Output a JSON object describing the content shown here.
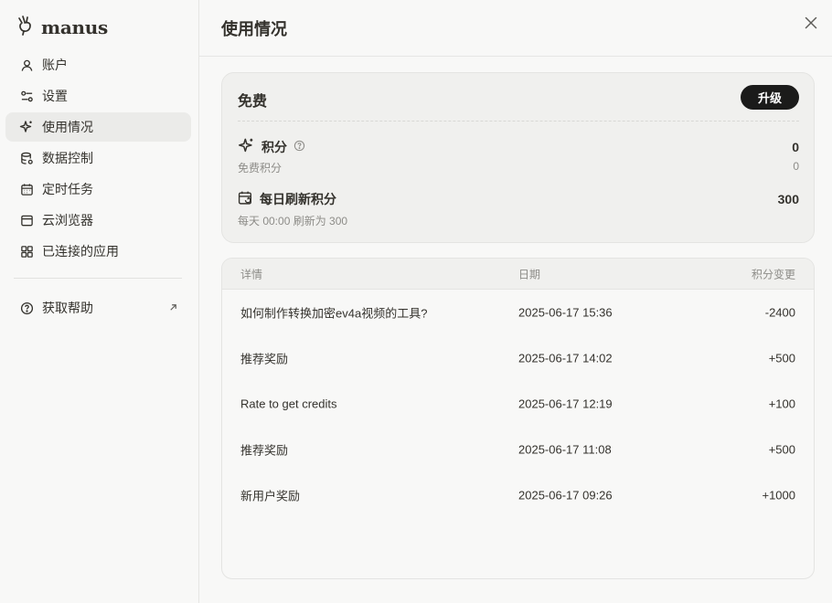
{
  "brand": {
    "name": "manus"
  },
  "sidebar": {
    "items": [
      {
        "label": "账户",
        "icon": "user-icon"
      },
      {
        "label": "设置",
        "icon": "sliders-icon"
      },
      {
        "label": "使用情况",
        "icon": "sparkle-icon",
        "active": true
      },
      {
        "label": "数据控制",
        "icon": "database-icon"
      },
      {
        "label": "定时任务",
        "icon": "calendar-icon"
      },
      {
        "label": "云浏览器",
        "icon": "browser-icon"
      },
      {
        "label": "已连接的应用",
        "icon": "grid-icon"
      }
    ],
    "help": {
      "label": "获取帮助",
      "icon": "help-circle-icon",
      "ext_icon": "external-arrow-icon"
    }
  },
  "header": {
    "title": "使用情况"
  },
  "plan": {
    "name": "免费",
    "upgrade_label": "升级",
    "credits": {
      "label": "积分",
      "value": "0",
      "sub_label": "免费积分",
      "sub_value": "0"
    },
    "daily": {
      "label": "每日刷新积分",
      "value": "300",
      "sub_label": "每天 00:00 刷新为 300"
    }
  },
  "table": {
    "headers": {
      "detail": "详情",
      "date": "日期",
      "change": "积分变更"
    },
    "rows": [
      {
        "detail": "如何制作转换加密ev4a视频的工具?",
        "date": "2025-06-17 15:36",
        "change": "-2400"
      },
      {
        "detail": "推荐奖励",
        "date": "2025-06-17 14:02",
        "change": "+500"
      },
      {
        "detail": "Rate to get credits",
        "date": "2025-06-17 12:19",
        "change": "+100"
      },
      {
        "detail": "推荐奖励",
        "date": "2025-06-17 11:08",
        "change": "+500"
      },
      {
        "detail": "新用户奖励",
        "date": "2025-06-17 09:26",
        "change": "+1000"
      }
    ]
  },
  "colors": {
    "accent_dark": "#1b1b1a",
    "text": "#34322d",
    "muted": "#8d8c88",
    "active_bg": "#ebebe9"
  }
}
